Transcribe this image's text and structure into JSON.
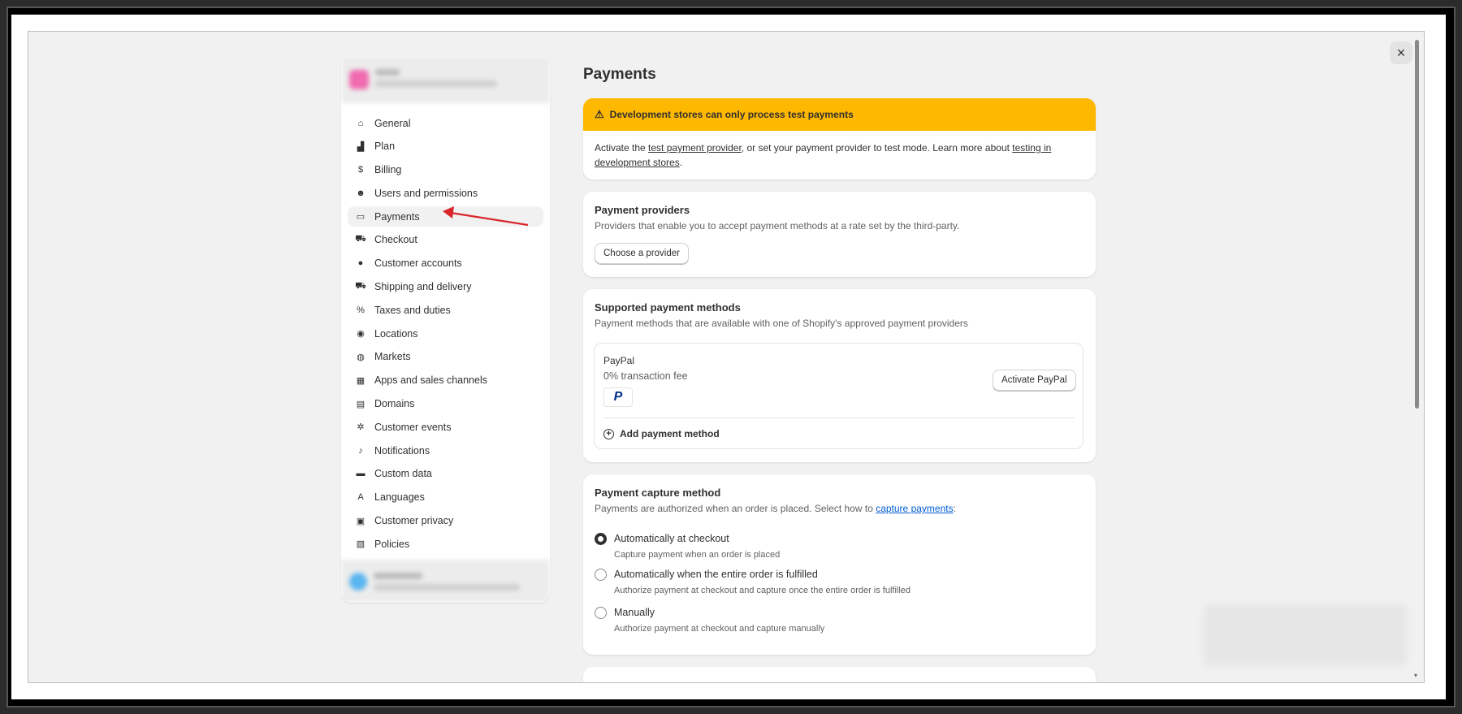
{
  "window": {
    "close_label": "×"
  },
  "sidebar": {
    "items": [
      {
        "label": "General",
        "icon": "store-icon",
        "glyph": "⌂"
      },
      {
        "label": "Plan",
        "icon": "chart-icon",
        "glyph": "▟"
      },
      {
        "label": "Billing",
        "icon": "receipt-icon",
        "glyph": "$"
      },
      {
        "label": "Users and permissions",
        "icon": "users-icon",
        "glyph": "☻"
      },
      {
        "label": "Payments",
        "icon": "payment-icon",
        "glyph": "▭"
      },
      {
        "label": "Checkout",
        "icon": "cart-icon",
        "glyph": "⛟"
      },
      {
        "label": "Customer accounts",
        "icon": "person-icon",
        "glyph": "●"
      },
      {
        "label": "Shipping and delivery",
        "icon": "truck-icon",
        "glyph": "⛟"
      },
      {
        "label": "Taxes and duties",
        "icon": "tax-icon",
        "glyph": "%"
      },
      {
        "label": "Locations",
        "icon": "location-icon",
        "glyph": "◉"
      },
      {
        "label": "Markets",
        "icon": "globe-icon",
        "glyph": "◍"
      },
      {
        "label": "Apps and sales channels",
        "icon": "apps-icon",
        "glyph": "▦"
      },
      {
        "label": "Domains",
        "icon": "domain-icon",
        "glyph": "▤"
      },
      {
        "label": "Customer events",
        "icon": "cursor-icon",
        "glyph": "✲"
      },
      {
        "label": "Notifications",
        "icon": "bell-icon",
        "glyph": "♪"
      },
      {
        "label": "Custom data",
        "icon": "database-icon",
        "glyph": "▬"
      },
      {
        "label": "Languages",
        "icon": "language-icon",
        "glyph": "A"
      },
      {
        "label": "Customer privacy",
        "icon": "lock-icon",
        "glyph": "▣"
      },
      {
        "label": "Policies",
        "icon": "policy-icon",
        "glyph": "▧"
      }
    ],
    "active_index": 4
  },
  "main": {
    "title": "Payments",
    "banner": {
      "title": "Development stores can only process test payments",
      "text_1": "Activate the ",
      "link_1": "test payment provider",
      "text_2": ", or set your payment provider to test mode. Learn more about ",
      "link_2": "testing in development stores",
      "text_3": "."
    },
    "providers": {
      "title": "Payment providers",
      "subtitle": "Providers that enable you to accept payment methods at a rate set by the third-party.",
      "button": "Choose a provider"
    },
    "supported": {
      "title": "Supported payment methods",
      "subtitle": "Payment methods that are available with one of Shopify's approved payment providers",
      "method_name": "PayPal",
      "method_fee": "0% transaction fee",
      "method_logo": "P",
      "activate_button": "Activate PayPal",
      "add_method": "Add payment method"
    },
    "capture": {
      "title": "Payment capture method",
      "subtitle_text": "Payments are authorized when an order is placed. Select how to ",
      "subtitle_link": "capture payments",
      "subtitle_end": ":",
      "options": [
        {
          "label": "Automatically at checkout",
          "help": "Capture payment when an order is placed",
          "checked": true
        },
        {
          "label": "Automatically when the entire order is fulfilled",
          "help": "Authorize payment at checkout and capture once the entire order is fulfilled",
          "checked": false
        },
        {
          "label": "Manually",
          "help": "Authorize payment at checkout and capture manually",
          "checked": false
        }
      ]
    }
  },
  "colors": {
    "banner": "#ffb800",
    "annotation_arrow": "#d9262b",
    "link_blue": "#005bd3"
  }
}
